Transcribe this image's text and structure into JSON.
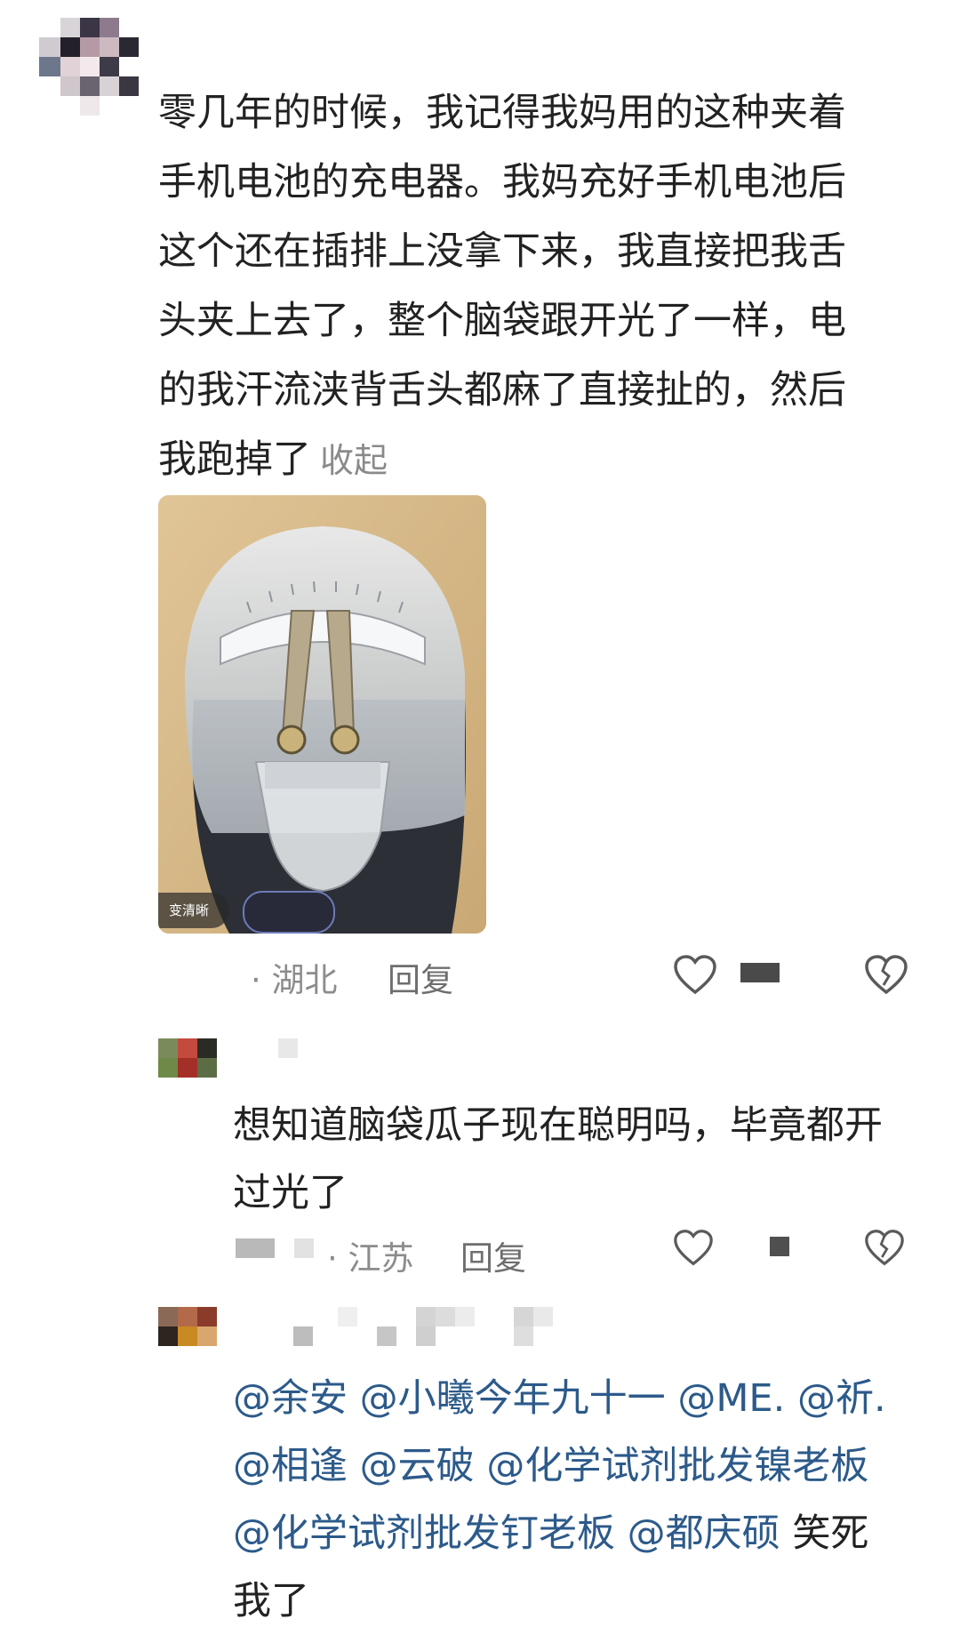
{
  "comment": {
    "lines": [
      "零几年的时候，我记得我妈用的这种夹着",
      "手机电池的充电器。我妈充好手机电池后",
      "这个还在插排上没拿下来，我直接把我舌",
      "头夹上去了，整个脑袋跟开光了一样，电",
      "的我汗流浃背舌头都麻了直接扯的，然后",
      "我跑掉了"
    ],
    "collapse_label": "收起",
    "image_badge": "变清晰",
    "location": "· 湖北",
    "reply_label": "回复",
    "icons": [
      "heart-icon",
      "broken-heart-icon"
    ]
  },
  "reply1": {
    "lines": [
      "想知道脑袋瓜子现在聪明吗，毕竟都开",
      "过光了"
    ],
    "location": "· 江苏",
    "reply_label": "回复"
  },
  "reply2": {
    "lines": [
      "@余安 @小曦今年九十一 @ME. @祈.",
      "@相逢 @云破 @化学试剂批发镍老板",
      "@化学试剂批发钉老板 @都庆硕 "
    ],
    "tail": "笑死",
    "last_line": "我了"
  },
  "colors": {
    "mention": "#2c5a8a",
    "meta": "#8c8c8c"
  }
}
